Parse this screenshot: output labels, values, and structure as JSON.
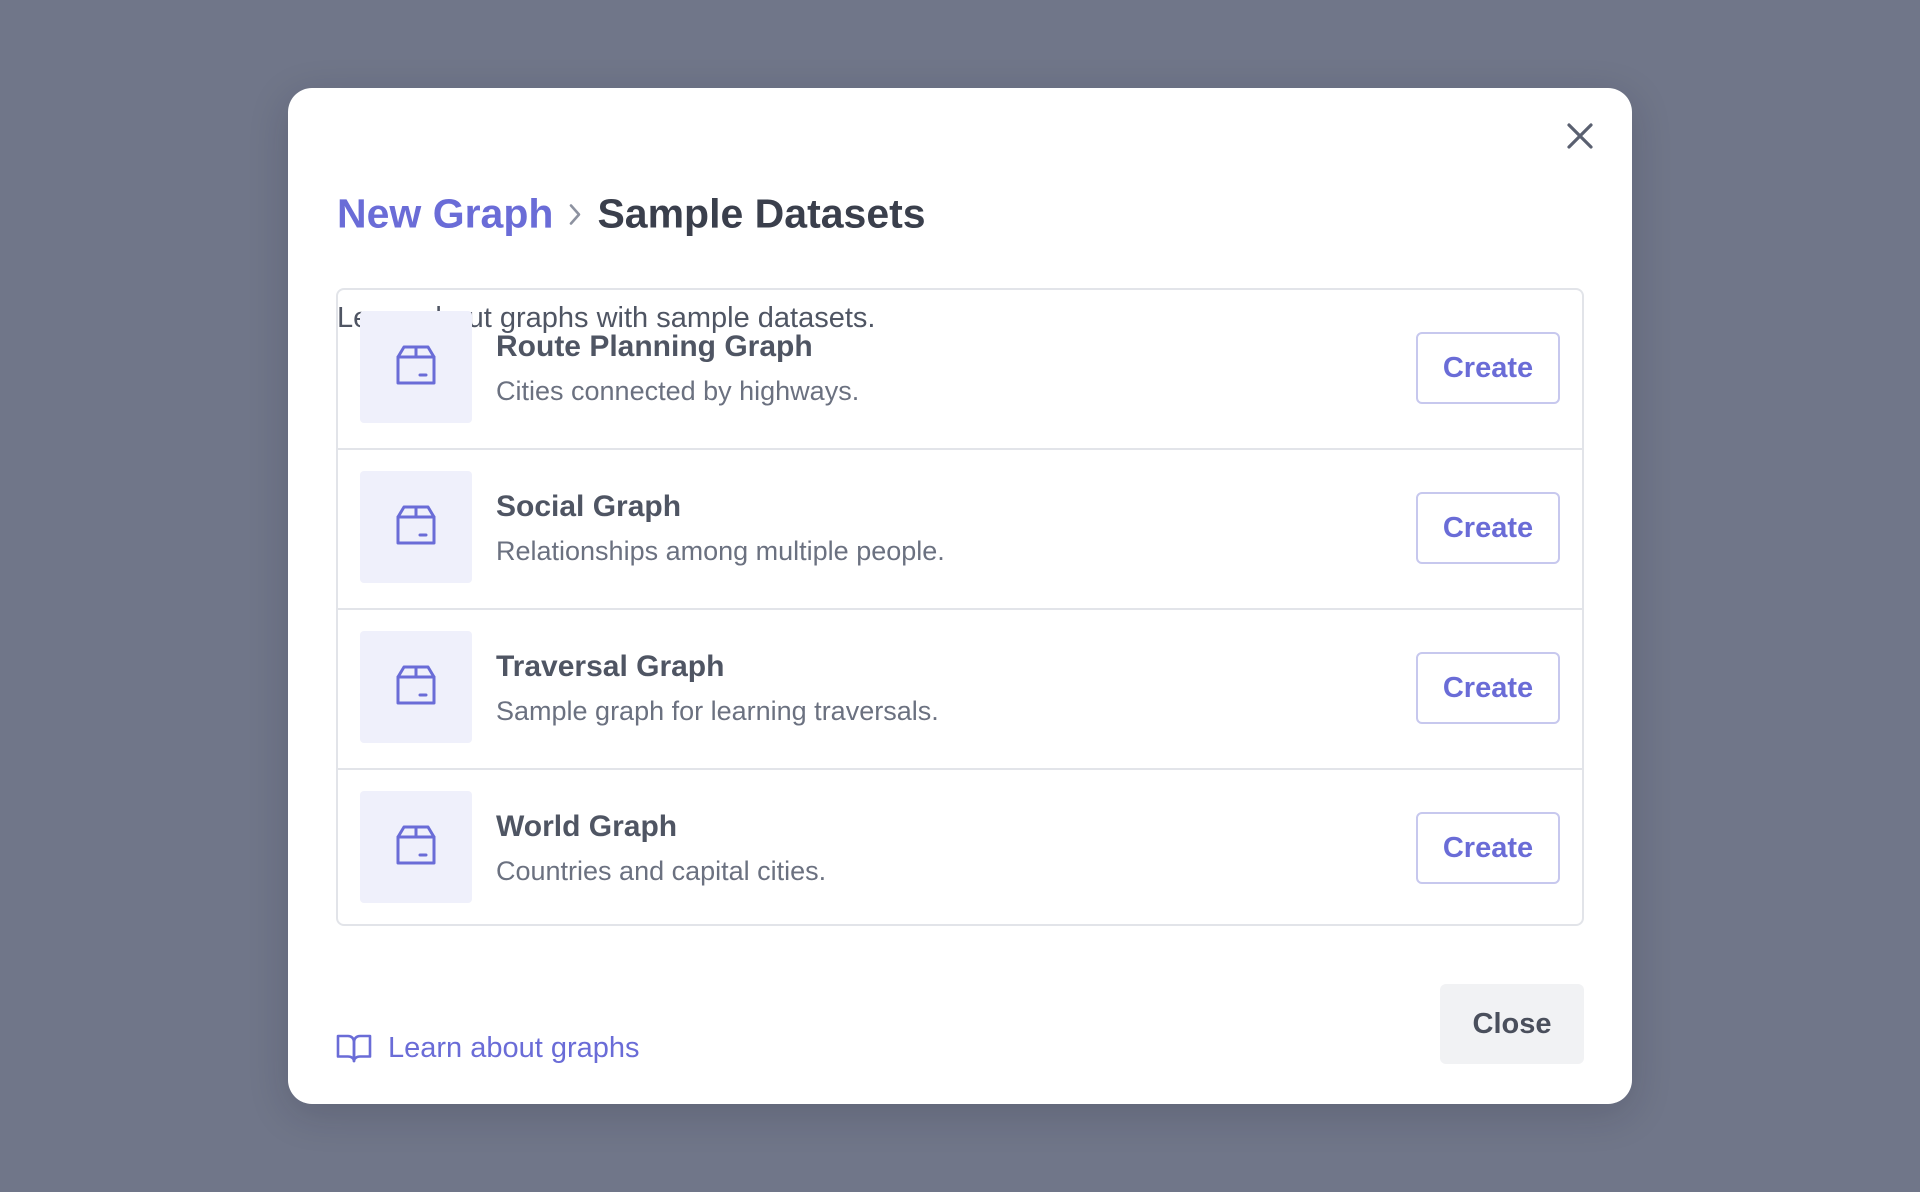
{
  "dialog": {
    "breadcrumb": {
      "parent": "New Graph",
      "current": "Sample Datasets"
    },
    "subtitle": "Learn about graphs with sample datasets.",
    "datasets": [
      {
        "name": "Route Planning Graph",
        "description": "Cities connected by highways.",
        "action": "Create",
        "icon": "package-icon"
      },
      {
        "name": "Social Graph",
        "description": "Relationships among multiple people.",
        "action": "Create",
        "icon": "package-icon"
      },
      {
        "name": "Traversal Graph",
        "description": "Sample graph for learning traversals.",
        "action": "Create",
        "icon": "package-icon"
      },
      {
        "name": "World Graph",
        "description": "Countries and capital cities.",
        "action": "Create",
        "icon": "package-icon"
      }
    ],
    "footer": {
      "learn_link": "Learn about graphs",
      "learn_icon": "book-open-icon",
      "close_label": "Close"
    },
    "close_icon": "close-icon"
  },
  "colors": {
    "backdrop": "#707689",
    "accent": "#6a6cd7",
    "tile_bg": "#eff0fb",
    "border": "#e2e4e9",
    "heading": "#3a3f4c"
  }
}
